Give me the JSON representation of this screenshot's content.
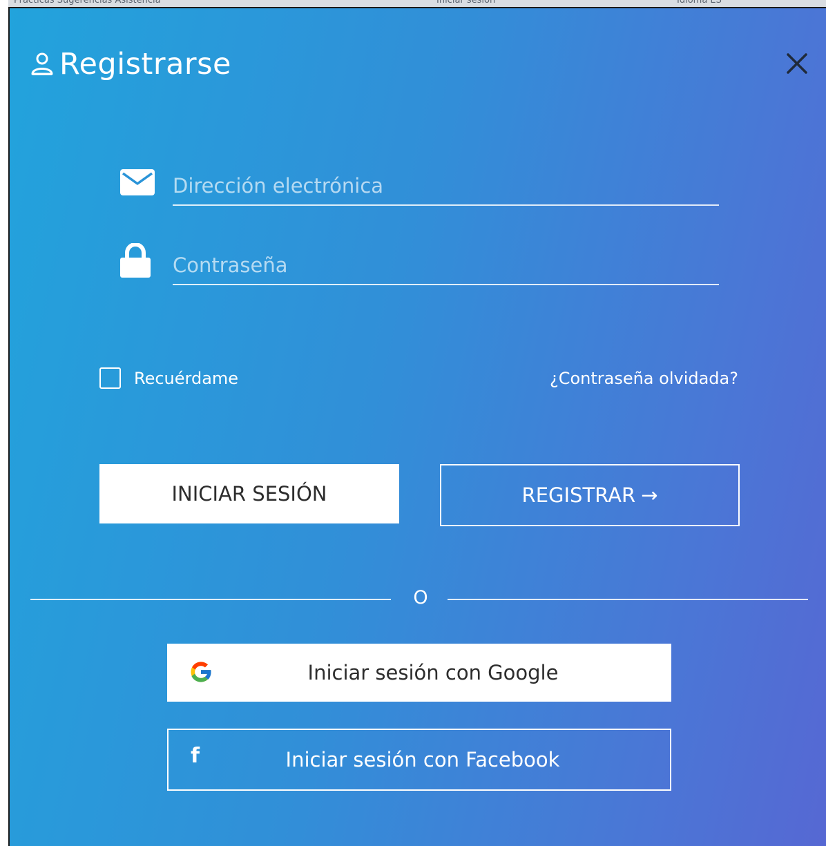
{
  "top_strip": {
    "text_left": "Prácticas  Sugerencias  Asistencia",
    "text_mid": "Iniciar sesión",
    "text_right": "Idioma  ES"
  },
  "modal": {
    "title": "Registrarse",
    "title_icon": "user-icon",
    "close_icon": "close-icon",
    "colors": {
      "gradient_start": "#22a3dc",
      "gradient_end": "#5668d3",
      "foreground": "#ffffff"
    }
  },
  "form": {
    "email": {
      "icon": "envelope-icon",
      "placeholder": "Dirección electrónica",
      "value": ""
    },
    "password": {
      "icon": "lock-icon",
      "placeholder": "Contraseña",
      "value": ""
    },
    "remember_label": "Recuérdame",
    "remember_checked": false,
    "forgot_label": "¿Contraseña olvidada?"
  },
  "actions": {
    "login_label": "INICIAR SESIÓN",
    "register_label": "REGISTRAR",
    "register_arrow": "→"
  },
  "divider": {
    "text": "O"
  },
  "social": {
    "google_label": "Iniciar sesión con Google",
    "google_icon": "google-icon",
    "facebook_label": "Iniciar sesión con Facebook",
    "facebook_icon_glyph": "f"
  }
}
